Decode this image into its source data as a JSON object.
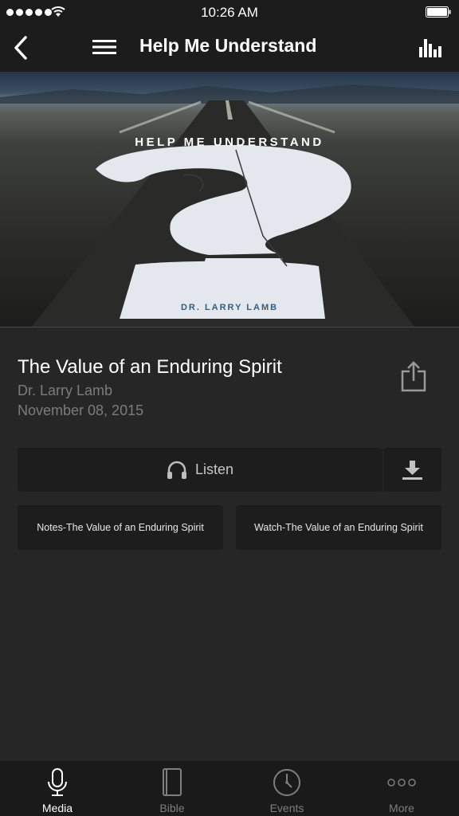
{
  "status_bar": {
    "time": "10:26 AM",
    "signal_icon": "signal-dots-icon",
    "wifi_icon": "wifi-icon",
    "battery_icon": "battery-icon"
  },
  "nav": {
    "title": "Help Me Understand",
    "back_icon": "chevron-left-icon",
    "menu_icon": "hamburger-menu-icon",
    "stats_icon": "bar-chart-icon"
  },
  "hero": {
    "series_title": "HELP ME UNDERSTAND",
    "author": "DR. LARRY LAMB"
  },
  "sermon": {
    "title": "The Value of an Enduring Spirit",
    "speaker": "Dr. Larry Lamb",
    "date": "November 08, 2015",
    "share_icon": "share-icon"
  },
  "actions": {
    "listen_label": "Listen",
    "listen_icon": "headphones-icon",
    "download_icon": "download-icon",
    "notes_label": "Notes-The Value of an Enduring Spirit",
    "watch_label": "Watch-The Value of an Enduring Spirit"
  },
  "tabs": [
    {
      "label": "Media",
      "icon": "microphone-icon",
      "active": true
    },
    {
      "label": "Bible",
      "icon": "book-icon",
      "active": false
    },
    {
      "label": "Events",
      "icon": "clock-icon",
      "active": false
    },
    {
      "label": "More",
      "icon": "more-dots-icon",
      "active": false
    }
  ],
  "colors": {
    "background": "#262626",
    "bar_background": "#1c1c1c",
    "button_background": "#1d1d1d",
    "secondary_text": "#7c7c7c",
    "author_blue": "#345d7d"
  }
}
